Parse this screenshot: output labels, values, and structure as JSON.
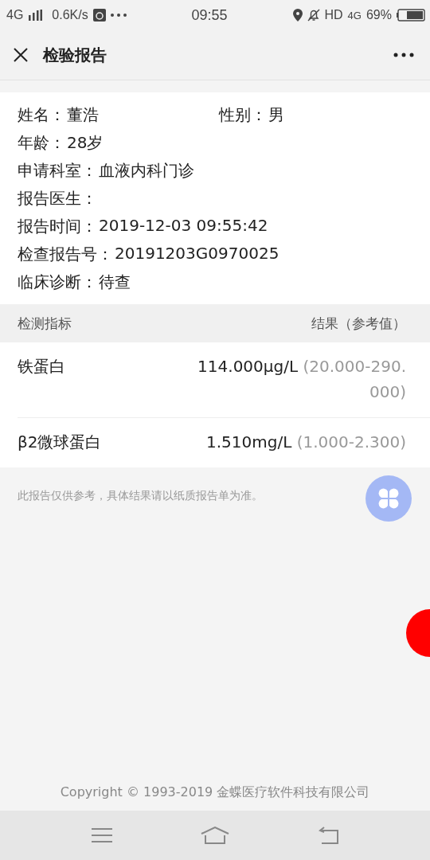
{
  "status_bar": {
    "network": "4G",
    "speed": "0.6K/s",
    "time": "09:55",
    "hd": "HD",
    "network_right": "4G",
    "battery": "69%"
  },
  "header": {
    "title": "检验报告"
  },
  "patient": [
    [
      {
        "label": "姓名：",
        "value": "董浩"
      },
      {
        "label": "性别：",
        "value": "男"
      }
    ],
    [
      {
        "label": "年龄：",
        "value": "28岁"
      }
    ],
    [
      {
        "label": "申请科室：",
        "value": "血液内科门诊"
      }
    ],
    [
      {
        "label": "报告医生："
      }
    ],
    [
      {
        "label": "报告时间：",
        "value": "2019-12-03 09:55:42"
      }
    ],
    [
      {
        "label": "检查报告号：",
        "value": "20191203G0970025"
      }
    ],
    [
      {
        "label": "临床诊断：",
        "value": "待查"
      }
    ]
  ],
  "table": {
    "columns": [
      "检测指标",
      "结果（参考值）"
    ],
    "rows": [
      {
        "name": "铁蛋白",
        "result": "114.000μg/L",
        "reference": "(20.000-290.000)"
      },
      {
        "name": "β2微球蛋白",
        "result": "1.510mg/L",
        "reference": "(1.000-2.300)"
      }
    ]
  },
  "note": "此报告仅供参考，具体结果请以纸质报告单为准。",
  "footer": "Copyright © 1993-2019 金蝶医疗软件科技有限公司"
}
